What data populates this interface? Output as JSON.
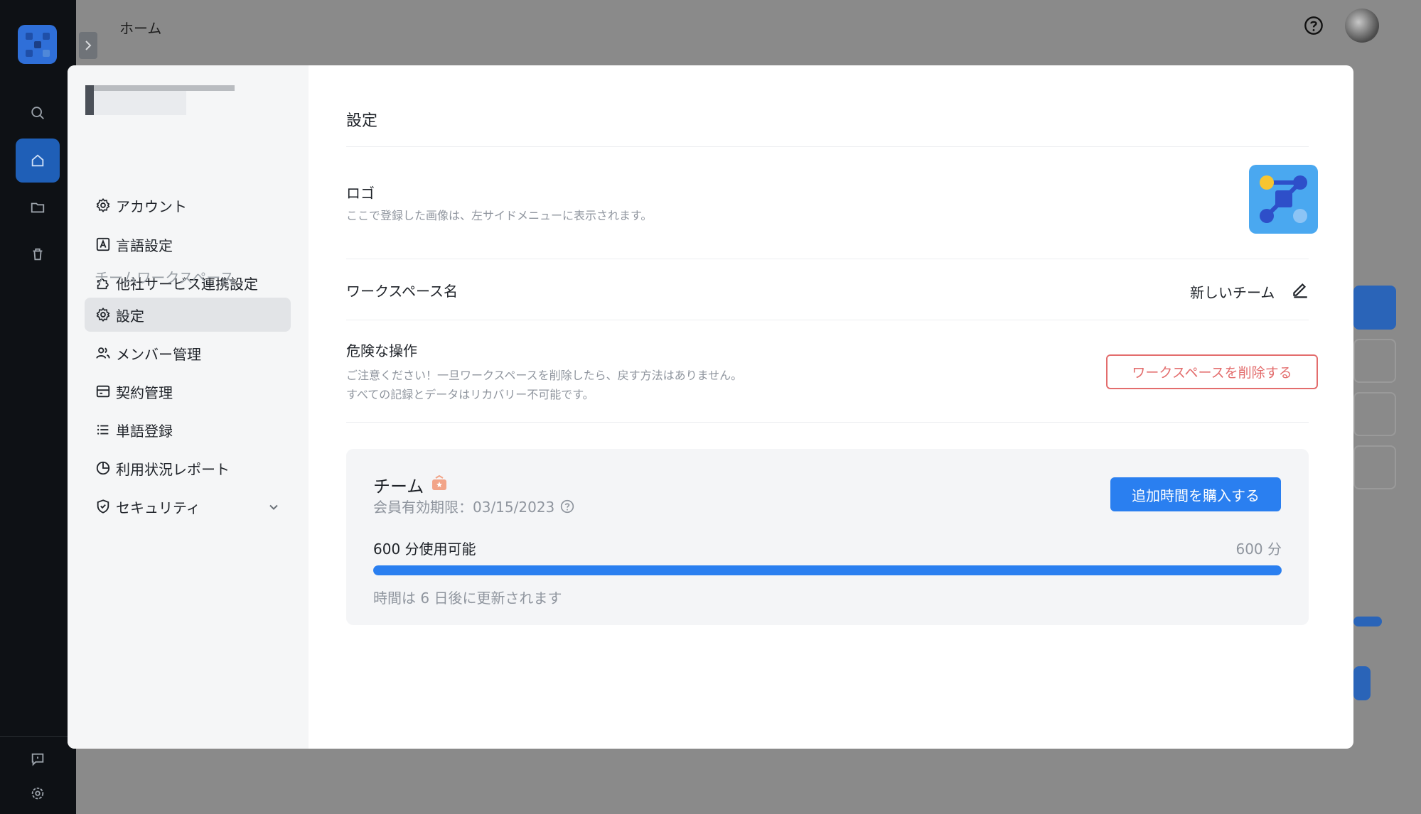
{
  "topbar": {
    "title": "ホーム"
  },
  "sidebar": {
    "personal_items": [
      {
        "label": "アカウント",
        "icon": "gear-icon"
      },
      {
        "label": "言語設定",
        "icon": "language-icon"
      },
      {
        "label": "他社サービス連携設定",
        "icon": "puzzle-icon"
      }
    ],
    "team_section_label": "チームワークスペース",
    "team_items": [
      {
        "label": "設定",
        "icon": "gear-icon",
        "active": true
      },
      {
        "label": "メンバー管理",
        "icon": "users-icon"
      },
      {
        "label": "契約管理",
        "icon": "billing-icon"
      },
      {
        "label": "単語登録",
        "icon": "list-icon"
      },
      {
        "label": "利用状況レポート",
        "icon": "pie-chart-icon"
      },
      {
        "label": "セキュリティ",
        "icon": "shield-icon",
        "has_dropdown": true
      }
    ]
  },
  "settings": {
    "title": "設定",
    "logo": {
      "label": "ロゴ",
      "description": "ここで登録した画像は、左サイドメニューに表示されます。"
    },
    "workspace_name": {
      "label": "ワークスペース名",
      "value": "新しいチーム"
    },
    "danger": {
      "label": "危険な操作",
      "description_line1": "ご注意ください！一旦ワークスペースを削除したら、戻す方法はありません。",
      "description_line2": "すべての記録とデータはリカバリー不可能です。",
      "delete_button": "ワークスペースを削除する"
    },
    "plan": {
      "name": "チーム",
      "expiry": "会員有効期限：03/15/2023",
      "buy_button": "追加時間を購入する",
      "usage_label": "600 分使用可能",
      "usage_total": "600 分",
      "usage_fraction": 1.0,
      "renew_text": "時間は 6 日後に更新されます"
    }
  },
  "colors": {
    "accent": "#2a7ff0",
    "danger": "#e36d6d",
    "rail": "#0e1115"
  }
}
